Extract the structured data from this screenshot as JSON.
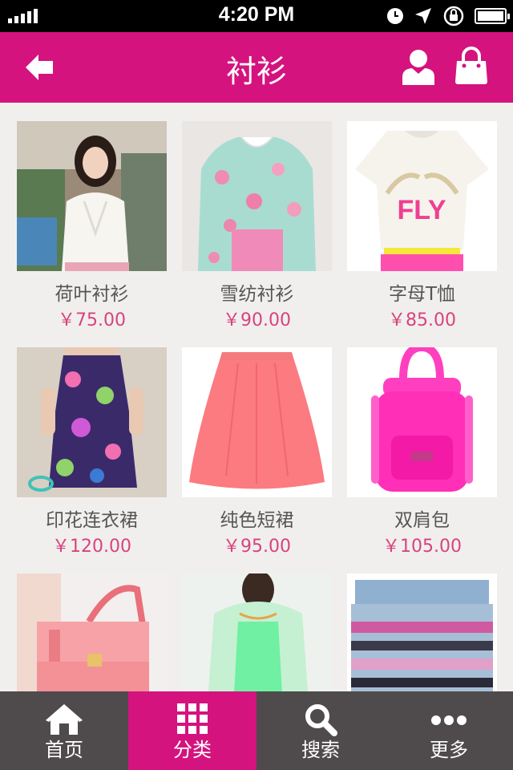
{
  "status_bar": {
    "time": "4:20 PM"
  },
  "nav": {
    "title": "衬衫",
    "icons": [
      "back-arrow-icon",
      "user-icon",
      "shopping-bag-icon"
    ]
  },
  "products": [
    {
      "name": "荷叶衬衫",
      "price": "￥75.00"
    },
    {
      "name": "雪纺衬衫",
      "price": "￥90.00"
    },
    {
      "name": "字母T恤",
      "price": "￥85.00"
    },
    {
      "name": "印花连衣裙",
      "price": "￥120.00"
    },
    {
      "name": "纯色短裙",
      "price": "￥95.00"
    },
    {
      "name": "双肩包",
      "price": "￥105.00"
    },
    {
      "name": "",
      "price": ""
    },
    {
      "name": "",
      "price": ""
    },
    {
      "name": "",
      "price": ""
    }
  ],
  "image_labels": {
    "tshirt_print": "FLY"
  },
  "tabs": [
    {
      "label": "首页",
      "icon": "home-icon",
      "active": false
    },
    {
      "label": "分类",
      "icon": "grid-icon",
      "active": true
    },
    {
      "label": "搜索",
      "icon": "search-icon",
      "active": false
    },
    {
      "label": "更多",
      "icon": "more-icon",
      "active": false
    }
  ],
  "colors": {
    "brand": "#d4137f",
    "price": "#d8437e",
    "tab_bar": "#4f4a4b",
    "background": "#f1efee"
  }
}
